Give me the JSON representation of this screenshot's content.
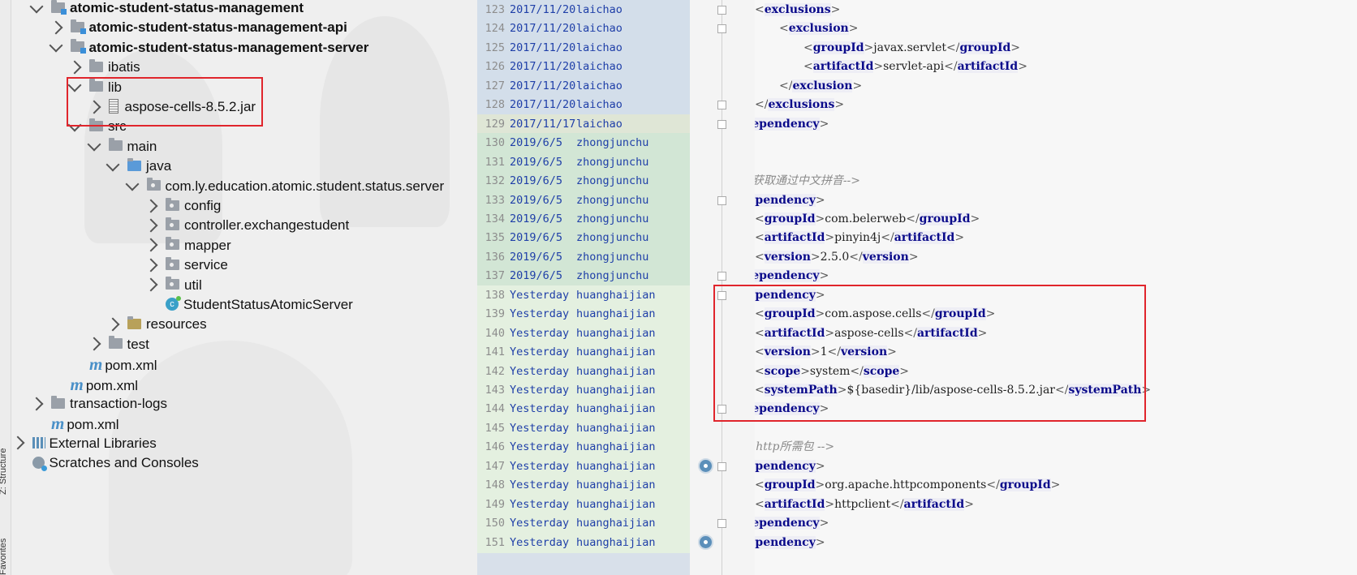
{
  "side_strip": {
    "labels": [
      "Z: Structure",
      "Favorites"
    ]
  },
  "tree": [
    {
      "label": "atomic-student-status-management",
      "bold": true,
      "chev": "down",
      "icon": "module-folder-icon",
      "depth": 2
    },
    {
      "label": "atomic-student-status-management-api",
      "bold": true,
      "chev": "right",
      "icon": "module-folder-icon",
      "depth": 3
    },
    {
      "label": "atomic-student-status-management-server",
      "bold": true,
      "chev": "down",
      "icon": "module-folder-icon",
      "depth": 3
    },
    {
      "label": "ibatis",
      "chev": "right",
      "icon": "folder-icon",
      "depth": 4
    },
    {
      "label": "lib",
      "chev": "down",
      "icon": "folder-icon",
      "depth": 4
    },
    {
      "label": "aspose-cells-8.5.2.jar",
      "chev": "right",
      "icon": "jar-icon",
      "depth": 5
    },
    {
      "label": "src",
      "chev": "down",
      "icon": "folder-icon",
      "depth": 4
    },
    {
      "label": "main",
      "chev": "down",
      "icon": "folder-icon",
      "depth": 5
    },
    {
      "label": "java",
      "chev": "down",
      "icon": "source-folder-icon",
      "depth": 6
    },
    {
      "label": "com.ly.education.atomic.student.status.server",
      "chev": "down",
      "icon": "package-icon",
      "depth": 7
    },
    {
      "label": "config",
      "chev": "right",
      "icon": "package-icon",
      "depth": 8
    },
    {
      "label": "controller.exchangestudent",
      "chev": "right",
      "icon": "package-icon",
      "depth": 8
    },
    {
      "label": "mapper",
      "chev": "right",
      "icon": "package-icon",
      "depth": 8
    },
    {
      "label": "service",
      "chev": "right",
      "icon": "package-icon",
      "depth": 8
    },
    {
      "label": "util",
      "chev": "right",
      "icon": "package-icon",
      "depth": 8
    },
    {
      "label": "StudentStatusAtomicServer",
      "chev": "none",
      "icon": "spring-class-icon",
      "depth": 8
    },
    {
      "label": "resources",
      "chev": "right",
      "icon": "resources-folder-icon",
      "depth": 6
    },
    {
      "label": "test",
      "chev": "right",
      "icon": "folder-icon",
      "depth": 5
    },
    {
      "label": "pom.xml",
      "chev": "none",
      "icon": "maven-icon",
      "depth": 4
    },
    {
      "label": "pom.xml",
      "chev": "none",
      "icon": "maven-icon",
      "depth": 3
    },
    {
      "label": "transaction-logs",
      "chev": "right",
      "icon": "folder-icon",
      "depth": 2
    },
    {
      "label": "pom.xml",
      "chev": "none",
      "icon": "maven-icon",
      "depth": 2
    },
    {
      "label": "External Libraries",
      "chev": "right",
      "icon": "libraries-icon",
      "depth": 1
    },
    {
      "label": "Scratches and Consoles",
      "chev": "none",
      "icon": "scratches-icon",
      "depth": 1
    }
  ],
  "blame": [
    {
      "line": "123",
      "date": "2017/11/20",
      "author": "laichao",
      "color": "#d3deea"
    },
    {
      "line": "124",
      "date": "2017/11/20",
      "author": "laichao",
      "color": "#d3deea"
    },
    {
      "line": "125",
      "date": "2017/11/20",
      "author": "laichao",
      "color": "#d3deea"
    },
    {
      "line": "126",
      "date": "2017/11/20",
      "author": "laichao",
      "color": "#d3deea"
    },
    {
      "line": "127",
      "date": "2017/11/20",
      "author": "laichao",
      "color": "#d3deea"
    },
    {
      "line": "128",
      "date": "2017/11/20",
      "author": "laichao",
      "color": "#d3deea"
    },
    {
      "line": "129",
      "date": "2017/11/17",
      "author": "laichao",
      "color": "#dfe6d6"
    },
    {
      "line": "130",
      "date": "2019/6/5",
      "author": "zhongjunchu",
      "color": "#d2e6d5"
    },
    {
      "line": "131",
      "date": "2019/6/5",
      "author": "zhongjunchu",
      "color": "#d2e6d5"
    },
    {
      "line": "132",
      "date": "2019/6/5",
      "author": "zhongjunchu",
      "color": "#d2e6d5"
    },
    {
      "line": "133",
      "date": "2019/6/5",
      "author": "zhongjunchu",
      "color": "#d2e6d5"
    },
    {
      "line": "134",
      "date": "2019/6/5",
      "author": "zhongjunchu",
      "color": "#d2e6d5"
    },
    {
      "line": "135",
      "date": "2019/6/5",
      "author": "zhongjunchu",
      "color": "#d2e6d5"
    },
    {
      "line": "136",
      "date": "2019/6/5",
      "author": "zhongjunchu",
      "color": "#d2e6d5"
    },
    {
      "line": "137",
      "date": "2019/6/5",
      "author": "zhongjunchu",
      "color": "#d2e6d5"
    },
    {
      "line": "138",
      "date": "Yesterday",
      "author": "huanghaijian",
      "color": "#e4f0e0"
    },
    {
      "line": "139",
      "date": "Yesterday",
      "author": "huanghaijian",
      "color": "#e4f0e0"
    },
    {
      "line": "140",
      "date": "Yesterday",
      "author": "huanghaijian",
      "color": "#e4f0e0"
    },
    {
      "line": "141",
      "date": "Yesterday",
      "author": "huanghaijian",
      "color": "#e4f0e0"
    },
    {
      "line": "142",
      "date": "Yesterday",
      "author": "huanghaijian",
      "color": "#e4f0e0"
    },
    {
      "line": "143",
      "date": "Yesterday",
      "author": "huanghaijian",
      "color": "#e4f0e0"
    },
    {
      "line": "144",
      "date": "Yesterday",
      "author": "huanghaijian",
      "color": "#e4f0e0"
    },
    {
      "line": "145",
      "date": "Yesterday",
      "author": "huanghaijian",
      "color": "#e4f0e0"
    },
    {
      "line": "146",
      "date": "Yesterday",
      "author": "huanghaijian",
      "color": "#e4f0e0"
    },
    {
      "line": "147",
      "date": "Yesterday",
      "author": "huanghaijian",
      "color": "#e4f0e0"
    },
    {
      "line": "148",
      "date": "Yesterday",
      "author": "huanghaijian",
      "color": "#e4f0e0"
    },
    {
      "line": "149",
      "date": "Yesterday",
      "author": "huanghaijian",
      "color": "#e4f0e0"
    },
    {
      "line": "150",
      "date": "Yesterday",
      "author": "huanghaijian",
      "color": "#e4f0e0"
    },
    {
      "line": "151",
      "date": "Yesterday",
      "author": "huanghaijian",
      "color": "#e4f0e0"
    }
  ],
  "code": [
    {
      "indent": 1,
      "parts": [
        {
          "t": "<",
          "c": "tb"
        },
        {
          "t": "exclusions",
          "c": "tag"
        },
        {
          "t": ">",
          "c": "tb"
        }
      ]
    },
    {
      "indent": 2,
      "parts": [
        {
          "t": "<",
          "c": "tb"
        },
        {
          "t": "exclusion",
          "c": "tag"
        },
        {
          "t": ">",
          "c": "tb"
        }
      ]
    },
    {
      "indent": 3,
      "parts": [
        {
          "t": "<",
          "c": "tb"
        },
        {
          "t": "groupId",
          "c": "tag"
        },
        {
          "t": ">",
          "c": "tb"
        },
        {
          "t": "javax.servlet",
          "c": "tv"
        },
        {
          "t": "</",
          "c": "tb"
        },
        {
          "t": "groupId",
          "c": "tag"
        },
        {
          "t": ">",
          "c": "tb"
        }
      ]
    },
    {
      "indent": 3,
      "parts": [
        {
          "t": "<",
          "c": "tb"
        },
        {
          "t": "artifactId",
          "c": "tag"
        },
        {
          "t": ">",
          "c": "tb"
        },
        {
          "t": "servlet-api",
          "c": "tv"
        },
        {
          "t": "</",
          "c": "tb"
        },
        {
          "t": "artifactId",
          "c": "tag"
        },
        {
          "t": ">",
          "c": "tb"
        }
      ]
    },
    {
      "indent": 2,
      "parts": [
        {
          "t": "</",
          "c": "tb"
        },
        {
          "t": "exclusion",
          "c": "tag"
        },
        {
          "t": ">",
          "c": "tb"
        }
      ]
    },
    {
      "indent": 1,
      "parts": [
        {
          "t": "</",
          "c": "tb"
        },
        {
          "t": "exclusions",
          "c": "tag"
        },
        {
          "t": ">",
          "c": "tb"
        }
      ]
    },
    {
      "indent": 0,
      "parts": [
        {
          "t": "</",
          "c": "tb"
        },
        {
          "t": "dependency",
          "c": "tag"
        },
        {
          "t": ">",
          "c": "tb"
        }
      ]
    },
    {
      "indent": 0,
      "parts": []
    },
    {
      "indent": 0,
      "parts": []
    },
    {
      "indent": 0,
      "parts": [
        {
          "t": "<!--获取通过中文拼音-->",
          "c": "comment"
        }
      ]
    },
    {
      "indent": 0,
      "parts": [
        {
          "t": "<",
          "c": "tb"
        },
        {
          "t": "dependency",
          "c": "tag"
        },
        {
          "t": ">",
          "c": "tb"
        }
      ]
    },
    {
      "indent": 1,
      "parts": [
        {
          "t": "<",
          "c": "tb"
        },
        {
          "t": "groupId",
          "c": "tag"
        },
        {
          "t": ">",
          "c": "tb"
        },
        {
          "t": "com.belerweb",
          "c": "tv"
        },
        {
          "t": "</",
          "c": "tb"
        },
        {
          "t": "groupId",
          "c": "tag"
        },
        {
          "t": ">",
          "c": "tb"
        }
      ]
    },
    {
      "indent": 1,
      "parts": [
        {
          "t": "<",
          "c": "tb"
        },
        {
          "t": "artifactId",
          "c": "tag"
        },
        {
          "t": ">",
          "c": "tb"
        },
        {
          "t": "pinyin4j",
          "c": "tv"
        },
        {
          "t": "</",
          "c": "tb"
        },
        {
          "t": "artifactId",
          "c": "tag"
        },
        {
          "t": ">",
          "c": "tb"
        }
      ]
    },
    {
      "indent": 1,
      "parts": [
        {
          "t": "<",
          "c": "tb"
        },
        {
          "t": "version",
          "c": "tag"
        },
        {
          "t": ">",
          "c": "tb"
        },
        {
          "t": "2.5.0",
          "c": "tv"
        },
        {
          "t": "</",
          "c": "tb"
        },
        {
          "t": "version",
          "c": "tag"
        },
        {
          "t": ">",
          "c": "tb"
        }
      ]
    },
    {
      "indent": 0,
      "parts": [
        {
          "t": "</",
          "c": "tb"
        },
        {
          "t": "dependency",
          "c": "tag"
        },
        {
          "t": ">",
          "c": "tb"
        }
      ]
    },
    {
      "indent": 0,
      "parts": [
        {
          "t": "<",
          "c": "tb"
        },
        {
          "t": "dependency",
          "c": "tag"
        },
        {
          "t": ">",
          "c": "tb"
        }
      ]
    },
    {
      "indent": 1,
      "parts": [
        {
          "t": "<",
          "c": "tb"
        },
        {
          "t": "groupId",
          "c": "tag"
        },
        {
          "t": ">",
          "c": "tb"
        },
        {
          "t": "com.aspose.cells",
          "c": "tv"
        },
        {
          "t": "</",
          "c": "tb"
        },
        {
          "t": "groupId",
          "c": "tag"
        },
        {
          "t": ">",
          "c": "tb"
        }
      ]
    },
    {
      "indent": 1,
      "parts": [
        {
          "t": "<",
          "c": "tb"
        },
        {
          "t": "artifactId",
          "c": "tag"
        },
        {
          "t": ">",
          "c": "tb"
        },
        {
          "t": "aspose-cells",
          "c": "tv"
        },
        {
          "t": "</",
          "c": "tb"
        },
        {
          "t": "artifactId",
          "c": "tag"
        },
        {
          "t": ">",
          "c": "tb"
        }
      ]
    },
    {
      "indent": 1,
      "parts": [
        {
          "t": "<",
          "c": "tb"
        },
        {
          "t": "version",
          "c": "tag"
        },
        {
          "t": ">",
          "c": "tb"
        },
        {
          "t": "1",
          "c": "tv"
        },
        {
          "t": "</",
          "c": "tb"
        },
        {
          "t": "version",
          "c": "tag"
        },
        {
          "t": ">",
          "c": "tb"
        }
      ]
    },
    {
      "indent": 1,
      "parts": [
        {
          "t": "<",
          "c": "tb"
        },
        {
          "t": "scope",
          "c": "tag"
        },
        {
          "t": ">",
          "c": "tb"
        },
        {
          "t": "system",
          "c": "tv"
        },
        {
          "t": "</",
          "c": "tb"
        },
        {
          "t": "scope",
          "c": "tag"
        },
        {
          "t": ">",
          "c": "tb"
        }
      ]
    },
    {
      "indent": 1,
      "parts": [
        {
          "t": "<",
          "c": "tb"
        },
        {
          "t": "systemPath",
          "c": "tag"
        },
        {
          "t": ">",
          "c": "tb"
        },
        {
          "t": "${basedir}/lib/aspose-cells-8.5.2.jar",
          "c": "tv"
        },
        {
          "t": "</",
          "c": "tb"
        },
        {
          "t": "systemPath",
          "c": "tag"
        },
        {
          "t": ">",
          "c": "tb"
        }
      ]
    },
    {
      "indent": 0,
      "parts": [
        {
          "t": "</",
          "c": "tb"
        },
        {
          "t": "dependency",
          "c": "tag"
        },
        {
          "t": ">",
          "c": "tb"
        }
      ]
    },
    {
      "indent": 0,
      "parts": []
    },
    {
      "indent": 0,
      "parts": [
        {
          "t": "<!-- http所需包 -->",
          "c": "comment"
        }
      ]
    },
    {
      "indent": 0,
      "parts": [
        {
          "t": "<",
          "c": "tb"
        },
        {
          "t": "dependency",
          "c": "tag"
        },
        {
          "t": ">",
          "c": "tb"
        }
      ]
    },
    {
      "indent": 1,
      "parts": [
        {
          "t": "<",
          "c": "tb"
        },
        {
          "t": "groupId",
          "c": "tag"
        },
        {
          "t": ">",
          "c": "tb"
        },
        {
          "t": "org.apache.httpcomponents",
          "c": "tv"
        },
        {
          "t": "</",
          "c": "tb"
        },
        {
          "t": "groupId",
          "c": "tag"
        },
        {
          "t": ">",
          "c": "tb"
        }
      ]
    },
    {
      "indent": 1,
      "parts": [
        {
          "t": "<",
          "c": "tb"
        },
        {
          "t": "artifactId",
          "c": "tag"
        },
        {
          "t": ">",
          "c": "tb"
        },
        {
          "t": "httpclient",
          "c": "tv"
        },
        {
          "t": "</",
          "c": "tb"
        },
        {
          "t": "artifactId",
          "c": "tag"
        },
        {
          "t": ">",
          "c": "tb"
        }
      ]
    },
    {
      "indent": 0,
      "parts": [
        {
          "t": "</",
          "c": "tb"
        },
        {
          "t": "dependency",
          "c": "tag"
        },
        {
          "t": ">",
          "c": "tb"
        }
      ]
    },
    {
      "indent": 0,
      "parts": [
        {
          "t": "<",
          "c": "tb"
        },
        {
          "t": "dependency",
          "c": "tag"
        },
        {
          "t": ">",
          "c": "tb"
        }
      ]
    }
  ],
  "colors": {
    "highlight_box": "#e0252c",
    "tag": "#0a0a8a",
    "blame_text": "#1f3fa8"
  }
}
